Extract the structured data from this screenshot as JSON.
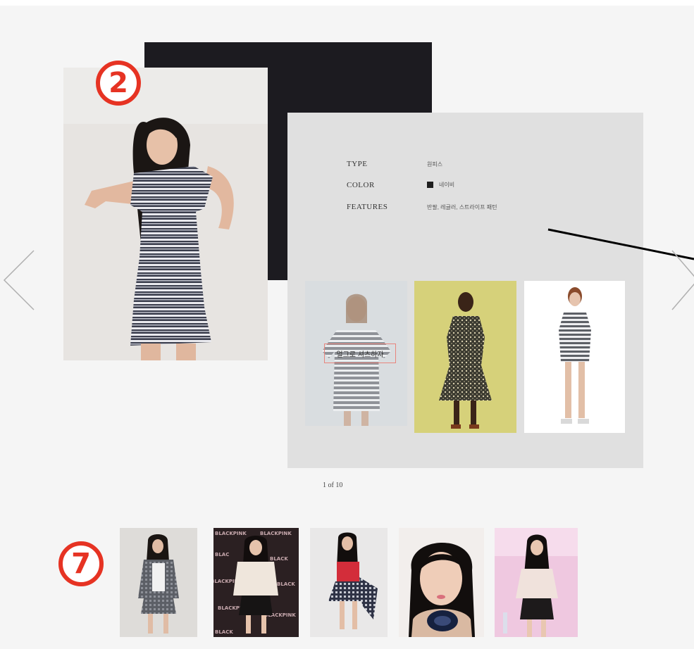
{
  "markers": {
    "top": "2",
    "bottom": "7"
  },
  "specs": [
    {
      "label": "TYPE",
      "value": "원피스"
    },
    {
      "label": "COLOR",
      "value": "네이비",
      "swatch": "#1e1e1e"
    },
    {
      "label": "FEATURES",
      "value": "반팔, 레귤러, 스트라이프 패턴"
    }
  ],
  "tag_label": "얼그로 셔츠하자",
  "pager": "1 of 10",
  "thumbnail_banner": [
    "BLACKPINK",
    "BLACKPINK",
    "BLAC",
    "BLACK",
    "BLACKPINK",
    "BLACK",
    "BLACKPINK",
    "BLACKPINK",
    "BLACK"
  ],
  "colors": {
    "accent": "#e63323",
    "panel": "#e0e0e0",
    "dark_block": "#1c1b20",
    "background": "#f5f5f5"
  },
  "icons": {
    "prev": "chevron-left-icon",
    "next": "chevron-right-icon"
  }
}
